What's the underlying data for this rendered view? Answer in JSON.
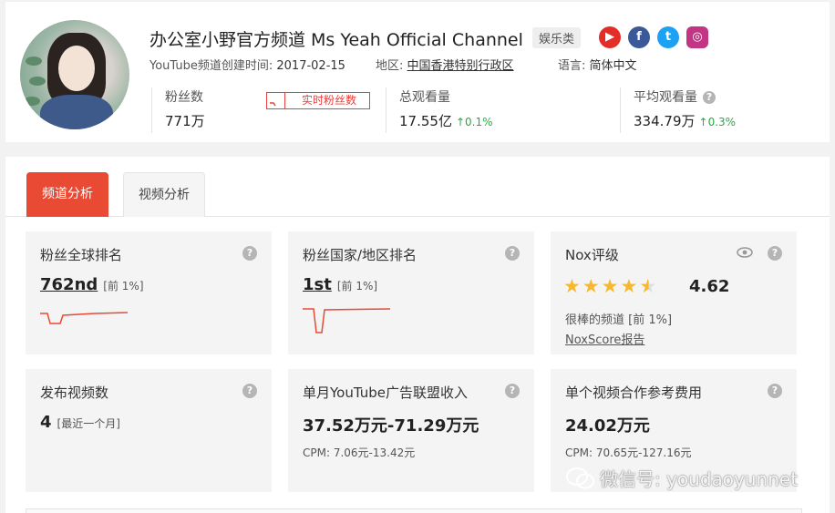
{
  "channel": {
    "title": "办公室小野官方频道 Ms Yeah Official Channel",
    "category": "娱乐类",
    "created_label": "YouTube频道创建时间:",
    "created_value": "2017-02-15",
    "region_label": "地区:",
    "region_value": "中国香港特别行政区",
    "language_label": "语言:",
    "language_value": "简体中文",
    "social_icons": [
      "youtube-icon",
      "facebook-icon",
      "twitter-icon",
      "instagram-icon"
    ]
  },
  "stats": {
    "fans_label": "粉丝数",
    "fans_value": "771万",
    "live_fans_button": "实时粉丝数",
    "views_label": "总观看量",
    "views_value": "17.55亿",
    "views_change": "0.1%",
    "avg_views_label": "平均观看量",
    "avg_views_value": "334.79万",
    "avg_views_change": "0.3%"
  },
  "tabs": [
    {
      "label": "频道分析",
      "active": true
    },
    {
      "label": "视频分析",
      "active": false
    }
  ],
  "cards": {
    "global_rank": {
      "title": "粉丝全球排名",
      "value": "762nd",
      "pct": "[前 1%]"
    },
    "country_rank": {
      "title": "粉丝国家/地区排名",
      "value": "1st",
      "pct": "[前 1%]"
    },
    "nox": {
      "title": "Nox评级",
      "score": "4.62",
      "stars_full": 4,
      "stars_half": 1,
      "desc": "很棒的频道 [前 1%]",
      "link": "NoxScore报告"
    },
    "videos": {
      "title": "发布视频数",
      "value": "4",
      "suffix": "[最近一个月]"
    },
    "ad_income": {
      "title": "单月YouTube广告联盟收入",
      "value": "37.52万元-71.29万元",
      "cpm": "CPM: 7.06元-13.42元"
    },
    "collab_fee": {
      "title": "单个视频合作参考费用",
      "value": "24.02万元",
      "cpm": "CPM: 70.65元-127.16元"
    }
  },
  "watermark": "微信号: youdaoyunnet",
  "colors": {
    "accent": "#e94a34",
    "up": "#2aa846",
    "star": "#f5b82e",
    "youtube": "#e52d27",
    "facebook": "#3b5998",
    "twitter": "#1da1f2",
    "instagram": "#c13584"
  }
}
